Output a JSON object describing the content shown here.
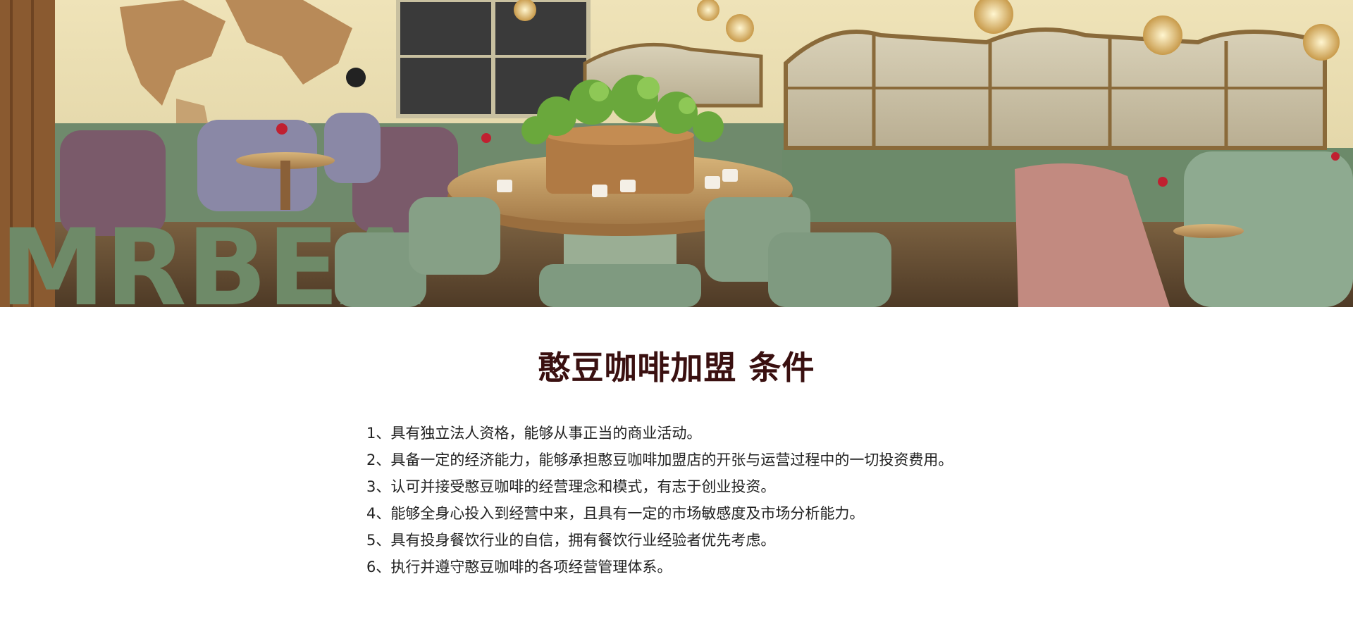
{
  "hero": {
    "sign_text": "MRBEA",
    "image_description_icon": "cafe-interior-image"
  },
  "colors": {
    "title": "#3a1010",
    "body_text": "#222222",
    "background": "#ffffff"
  },
  "section": {
    "title": "憨豆咖啡加盟 条件",
    "items": [
      "1、具有独立法人资格，能够从事正当的商业活动。",
      "2、具备一定的经济能力，能够承担憨豆咖啡加盟店的开张与运营过程中的一切投资费用。",
      "3、认可并接受憨豆咖啡的经营理念和模式，有志于创业投资。",
      "4、能够全身心投入到经营中来，且具有一定的市场敏感度及市场分析能力。",
      "5、具有投身餐饮行业的自信，拥有餐饮行业经验者优先考虑。",
      "6、执行并遵守憨豆咖啡的各项经营管理体系。"
    ]
  }
}
